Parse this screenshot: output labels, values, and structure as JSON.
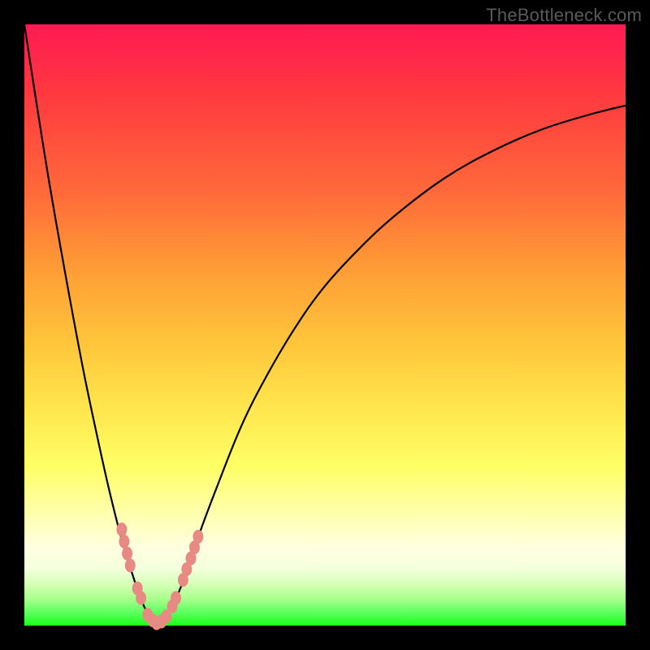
{
  "watermark": "TheBottleneck.com",
  "colors": {
    "background": "#000000",
    "curve_stroke": "#000000",
    "dot_fill": "#e88a84",
    "gradient_top": "#ff1a52",
    "gradient_bottom": "#1aff1a"
  },
  "chart_data": {
    "type": "line",
    "title": "",
    "xlabel": "",
    "ylabel": "",
    "x_range": [
      0,
      100
    ],
    "y_range": [
      0,
      100
    ],
    "note": "x is horizontal position (0–100 left→right), y is bottleneck % (0 at bottom/green, 100 at top/red); values are visual estimates",
    "series": [
      {
        "name": "left-branch",
        "x": [
          0.0,
          2.0,
          4.0,
          6.0,
          8.0,
          10.0,
          12.0,
          14.0,
          16.0,
          17.5,
          19.0,
          20.0,
          21.0,
          22.0
        ],
        "y": [
          100.0,
          87.0,
          74.5,
          63.0,
          52.0,
          41.5,
          32.0,
          23.0,
          15.0,
          10.0,
          5.5,
          3.0,
          1.2,
          0.0
        ]
      },
      {
        "name": "right-branch",
        "x": [
          22.0,
          23.5,
          25.0,
          27.0,
          29.0,
          32.0,
          36.0,
          40.0,
          45.0,
          50.0,
          56.0,
          62.0,
          70.0,
          78.0,
          86.0,
          94.0,
          100.0
        ],
        "y": [
          0.0,
          1.5,
          4.0,
          9.0,
          15.0,
          23.0,
          33.0,
          41.0,
          49.5,
          56.5,
          63.0,
          68.5,
          74.5,
          79.0,
          82.5,
          85.0,
          86.5
        ]
      }
    ],
    "points": {
      "name": "sample-dots",
      "coords": [
        [
          16.2,
          16.0
        ],
        [
          16.6,
          14.0
        ],
        [
          17.1,
          12.0
        ],
        [
          17.6,
          10.0
        ],
        [
          18.8,
          6.2
        ],
        [
          19.4,
          4.6
        ],
        [
          20.5,
          1.8
        ],
        [
          21.3,
          0.9
        ],
        [
          22.0,
          0.4
        ],
        [
          22.8,
          0.7
        ],
        [
          23.6,
          1.5
        ],
        [
          24.6,
          3.2
        ],
        [
          25.2,
          4.6
        ],
        [
          26.4,
          7.6
        ],
        [
          27.0,
          9.4
        ],
        [
          27.7,
          11.2
        ],
        [
          28.3,
          13.0
        ],
        [
          28.9,
          14.8
        ]
      ]
    },
    "optimal_x": 22.0
  }
}
